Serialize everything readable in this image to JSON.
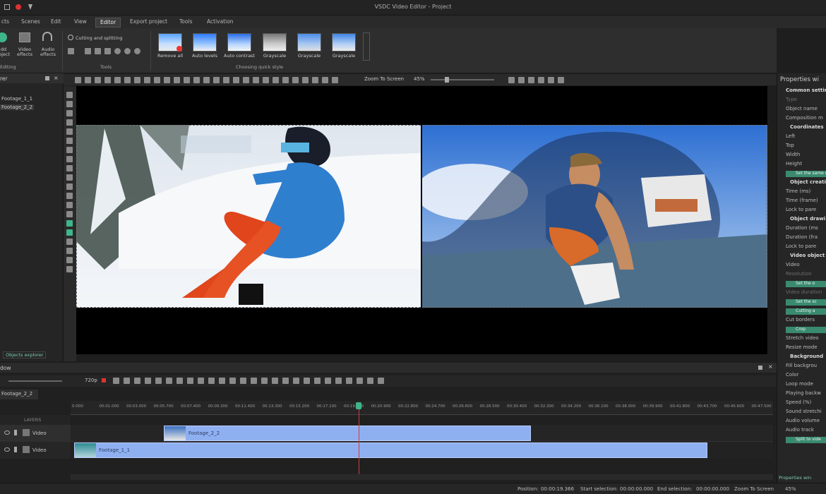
{
  "window": {
    "title": "VSDC Video Editor - Project"
  },
  "menu": {
    "items": [
      {
        "label": "cts"
      },
      {
        "label": "Scenes"
      },
      {
        "label": "Edit"
      },
      {
        "label": "View"
      },
      {
        "label": "Editor"
      },
      {
        "label": "Export project"
      },
      {
        "label": "Tools"
      },
      {
        "label": "Activation"
      }
    ],
    "active": "Editor"
  },
  "ribbon": {
    "add_object": "dd\nbject",
    "video_effects": "Video\neffects",
    "audio_effects": "Audio\neffects",
    "editing_group": "Editing",
    "cutting_splitting": "Cutting and splitting",
    "tools_group": "Tools",
    "quick_styles": [
      {
        "label": "Remove all"
      },
      {
        "label": "Auto levels"
      },
      {
        "label": "Auto contrast"
      },
      {
        "label": "Grayscale"
      },
      {
        "label": "Grayscale"
      },
      {
        "label": "Grayscale"
      }
    ],
    "quick_style_group": "Choosing quick style"
  },
  "toolbar": {
    "zoom_label": "Zoom To Screen",
    "zoom_value": "45%"
  },
  "left_panel": {
    "title": "rer",
    "items": [
      {
        "label": "Footage_1_1"
      },
      {
        "label": "Footage_2_2"
      }
    ],
    "tab": "Objects explorer"
  },
  "properties": {
    "title": "Properties wi",
    "rows": [
      {
        "text": "Common settin",
        "bold": true
      },
      {
        "text": "Type",
        "dim": true
      },
      {
        "text": "Object name"
      },
      {
        "text": "Composition m"
      },
      {
        "text": "Coordinates",
        "bold": true
      },
      {
        "text": "Left"
      },
      {
        "text": "Top"
      },
      {
        "text": "Width"
      },
      {
        "text": "Height"
      },
      {
        "btn": "Set the same siz"
      },
      {
        "text": "Object creati",
        "bold": true
      },
      {
        "text": "Time (ms)"
      },
      {
        "text": "Time (frame)"
      },
      {
        "text": "Lock to pare"
      },
      {
        "text": "Object drawi",
        "bold": true
      },
      {
        "text": "Duration (ms"
      },
      {
        "text": "Duration (fra"
      },
      {
        "text": "Lock to pare"
      },
      {
        "text": "Video object se",
        "bold": true
      },
      {
        "text": "Video"
      },
      {
        "text": "Resolution",
        "dim": true
      },
      {
        "btn": "Set the o"
      },
      {
        "text": "Video duration",
        "dim": true
      },
      {
        "btn": "Set the sc"
      },
      {
        "btn": "Cutting a"
      },
      {
        "text": "Cut borders"
      },
      {
        "btn": "Crop"
      },
      {
        "text": "Stretch video"
      },
      {
        "text": "Resize mode"
      },
      {
        "text": "Background",
        "bold": true
      },
      {
        "text": "Fill backgrou"
      },
      {
        "text": "Color"
      },
      {
        "text": "Loop mode"
      },
      {
        "text": "Playing backw"
      },
      {
        "text": "Speed (%)"
      },
      {
        "text": "Sound stretchi"
      },
      {
        "text": "Audio volume"
      },
      {
        "text": "Audio track"
      },
      {
        "btn": "Split to vide"
      }
    ],
    "bottom_tab": "Properties win"
  },
  "timeline": {
    "title": "dow",
    "quality": "720p",
    "tab": "Footage_2_2",
    "ruler": [
      "0:000",
      "00:01.000",
      "00:03.000",
      "00:05.700",
      "00:07.400",
      "00:09.300",
      "00:11.400",
      "00:13.300",
      "00:15.200",
      "00:17.100",
      "00:19.000",
      "00:20.900",
      "00:22.800",
      "00:24.700",
      "00:26.600",
      "00:28.500",
      "00:30.400",
      "00:32.300",
      "00:34.200",
      "00:36.100",
      "00:38.000",
      "00:39.900",
      "00:41.800",
      "00:43.700",
      "00:45.600",
      "00:47.500"
    ],
    "layers_label": "LAYERS",
    "tracks": [
      {
        "label": "Video"
      },
      {
        "label": "Video"
      }
    ],
    "clips": [
      {
        "label": "Footage_2_2"
      },
      {
        "label": "Footage_1_1"
      }
    ]
  },
  "status": {
    "position_label": "Position:",
    "position_value": "00:00:19.366",
    "start_label": "Start selection:",
    "start_value": "00:00:00.000",
    "end_label": "End selection:",
    "end_value": "00:00:00.000",
    "zoom_label": "Zoom To Screen",
    "zoom_value": "45%"
  },
  "colors": {
    "accent": "#3a8a6f",
    "clip": "#8fb0f0",
    "playhead": "#d23a3a"
  }
}
